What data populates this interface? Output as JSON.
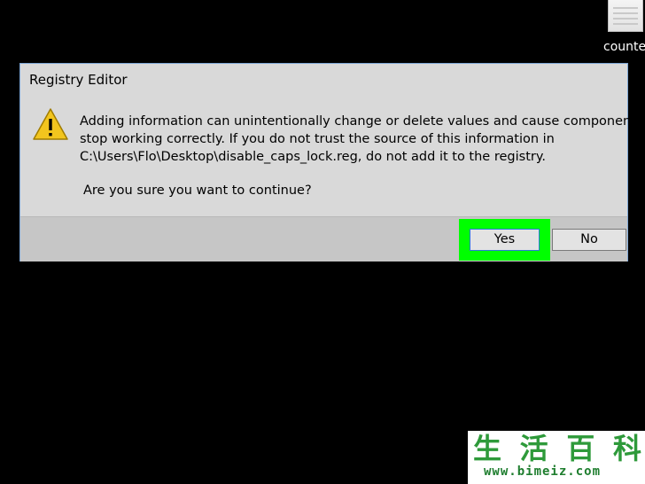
{
  "desktop": {
    "icon_label": "counter"
  },
  "dialog": {
    "title": "Registry Editor",
    "message_lines": [
      "Adding information can unintentionally change or delete values and cause components to",
      "stop working correctly. If you do not trust the source of this information in",
      "C:\\Users\\Flo\\Desktop\\disable_caps_lock.reg, do not add it to the registry."
    ],
    "question": "Are you sure you want to continue?",
    "buttons": {
      "yes": "Yes",
      "no": "No"
    },
    "icon": "warning-icon"
  },
  "watermark": {
    "glyphs": [
      "生",
      "活",
      "百",
      "科"
    ],
    "url": "www.bimeiz.com"
  },
  "colors": {
    "highlight": "#00ff00",
    "dialog_background": "#d9d9d9",
    "desktop_background": "#000000",
    "warning": "#f2c51e",
    "watermark_green": "#2e9a3a"
  }
}
